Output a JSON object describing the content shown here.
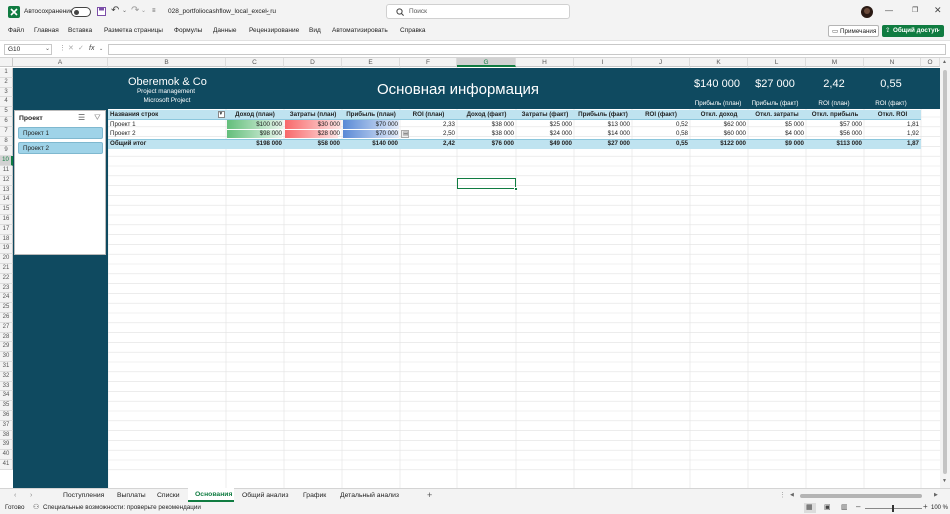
{
  "titlebar": {
    "autosave_label": "Автосохранение",
    "autosave_state": "off",
    "filename": "028_portfoliocashflow_local_excel_ru",
    "search_placeholder": "Поиск"
  },
  "menu": {
    "items": [
      "Файл",
      "Главная",
      "Вставка",
      "Разметка страницы",
      "Формулы",
      "Данные",
      "Рецензирование",
      "Вид",
      "Автоматизировать",
      "Справка"
    ],
    "comments_label": "Примечания",
    "share_label": "Общий доступ"
  },
  "formula_bar": {
    "name_box": "G10",
    "fx": "fx",
    "value": ""
  },
  "grid": {
    "columns": [
      "A",
      "B",
      "C",
      "D",
      "E",
      "F",
      "G",
      "H",
      "I",
      "J",
      "K",
      "L",
      "M",
      "N",
      "O"
    ],
    "rows": [
      "1",
      "2",
      "3",
      "4",
      "5",
      "6",
      "7",
      "8",
      "9",
      "10",
      "11",
      "12",
      "13",
      "14",
      "15",
      "16",
      "17",
      "18",
      "19",
      "20",
      "21",
      "22",
      "23",
      "24",
      "25",
      "26",
      "27",
      "28",
      "29",
      "30",
      "31",
      "32",
      "33",
      "34",
      "35",
      "36",
      "37",
      "38",
      "39",
      "40",
      "41"
    ],
    "selected_cell": "G10"
  },
  "dashboard": {
    "company": "Oberemok & Co",
    "subtitle1": "Project management",
    "subtitle2": "Microsoft Project",
    "title": "Основная информация",
    "kpis": [
      {
        "value": "$140 000",
        "label": "Прибыль (план)"
      },
      {
        "value": "$27 000",
        "label": "Прибыль (факт)"
      },
      {
        "value": "2,42",
        "label": "ROI (план)"
      },
      {
        "value": "0,55",
        "label": "ROI (факт)"
      }
    ]
  },
  "slicer": {
    "title": "Проект",
    "items": [
      "Проект 1",
      "Проект 2"
    ]
  },
  "pivot": {
    "headers": [
      "Названия строк",
      "Доход (план)",
      "Затраты (план)",
      "Прибыль (план)",
      "ROI (план)",
      "Доход (факт)",
      "Затраты (факт)",
      "Прибыль (факт)",
      "ROI (факт)",
      "Откл. доход",
      "Откл. затраты",
      "Откл. прибыль",
      "Откл. ROI"
    ],
    "rows": [
      {
        "name": "Проект 1",
        "cells": [
          "$100 000",
          "$30 000",
          "$70 000",
          "2,33",
          "$38 000",
          "$25 000",
          "$13 000",
          "0,52",
          "$62 000",
          "$5 000",
          "$57 000",
          "1,81"
        ]
      },
      {
        "name": "Проект 2",
        "cells": [
          "$98 000",
          "$28 000",
          "$70 000",
          "2,50",
          "$38 000",
          "$24 000",
          "$14 000",
          "0,58",
          "$60 000",
          "$4 000",
          "$56 000",
          "1,92"
        ]
      }
    ],
    "total": {
      "name": "Общий итог",
      "cells": [
        "$198 000",
        "$58 000",
        "$140 000",
        "2,42",
        "$76 000",
        "$49 000",
        "$27 000",
        "0,55",
        "$122 000",
        "$9 000",
        "$113 000",
        "1,87"
      ]
    }
  },
  "sheets": {
    "tabs": [
      "Поступления",
      "Выплаты",
      "Списки",
      "Основания",
      "Общий анализ",
      "График",
      "Детальный анализ"
    ],
    "active": "Основания"
  },
  "status": {
    "ready": "Готово",
    "accessibility": "Специальные возможности: проверьте рекомендации",
    "zoom": "100 %"
  },
  "colors": {
    "header_dark": "#0f4a60",
    "pivot_header": "#bfe3f0",
    "excel_green": "#107c41",
    "databar_green": "#63be7b",
    "databar_red": "#f8696b",
    "databar_blue": "#5a8ad6"
  }
}
